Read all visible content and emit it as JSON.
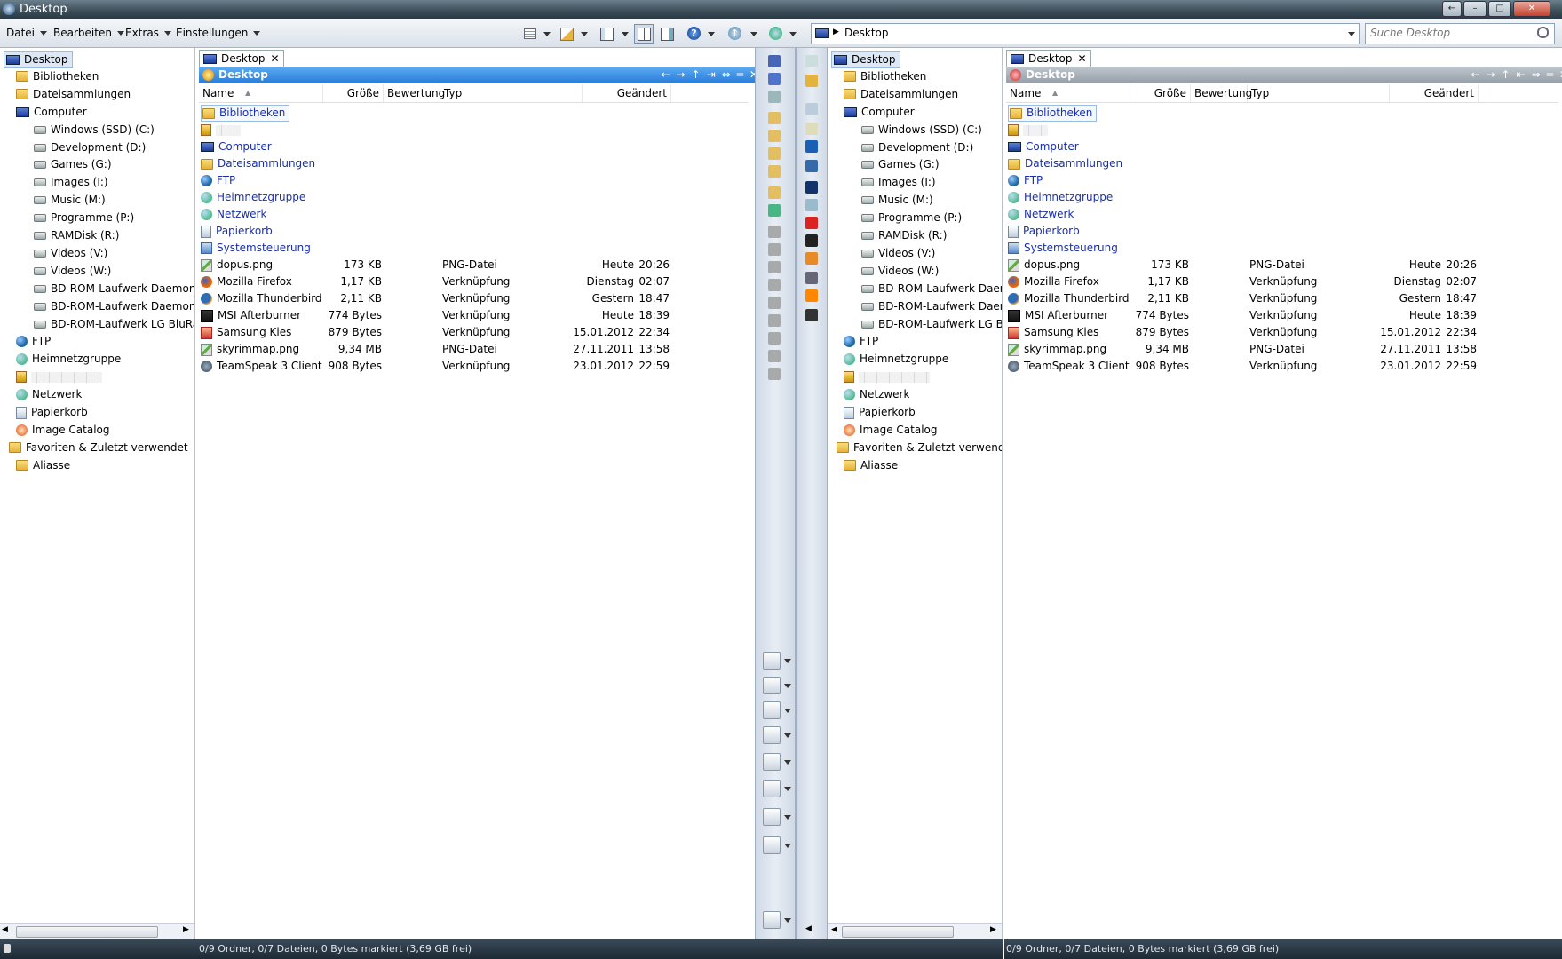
{
  "window": {
    "title": "Desktop",
    "buttons": [
      "←",
      "–",
      "□",
      "✕"
    ]
  },
  "menu": [
    "Datei",
    "Bearbeiten",
    "Extras",
    "Einstellungen"
  ],
  "address": {
    "path": "Desktop"
  },
  "search": {
    "placeholder": "Suche Desktop"
  },
  "tree": [
    {
      "label": "Desktop",
      "icon": "monitor-icon",
      "indent": 0
    },
    {
      "label": "Bibliotheken",
      "icon": "folder-icon",
      "indent": 1
    },
    {
      "label": "Dateisammlungen",
      "icon": "folder-icon",
      "indent": 1
    },
    {
      "label": "Computer",
      "icon": "monitor-icon",
      "indent": 1
    },
    {
      "label": "Windows (SSD) (C:)",
      "icon": "drive-icon",
      "indent": 2
    },
    {
      "label": "Development (D:)",
      "icon": "drive-icon",
      "indent": 2
    },
    {
      "label": "Games (G:)",
      "icon": "drive-icon",
      "indent": 2
    },
    {
      "label": "Images (I:)",
      "icon": "drive-icon",
      "indent": 2
    },
    {
      "label": "Music (M:)",
      "icon": "drive-icon",
      "indent": 2
    },
    {
      "label": "Programme (P:)",
      "icon": "drive-icon",
      "indent": 2
    },
    {
      "label": "RAMDisk (R:)",
      "icon": "drive-icon",
      "indent": 2
    },
    {
      "label": "Videos (V:)",
      "icon": "drive-icon",
      "indent": 2
    },
    {
      "label": "Videos (W:)",
      "icon": "drive-icon",
      "indent": 2
    },
    {
      "label": "BD-ROM-Laufwerk Daemon Tools",
      "icon": "drive-icon",
      "indent": 2
    },
    {
      "label": "BD-ROM-Laufwerk Daemon Tools",
      "icon": "drive-icon",
      "indent": 2
    },
    {
      "label": "BD-ROM-Laufwerk LG BluRay (Z:)",
      "icon": "drive-icon",
      "indent": 2
    },
    {
      "label": "FTP",
      "icon": "globe-icon",
      "indent": 1
    },
    {
      "label": "Heimnetzgruppe",
      "icon": "network-icon",
      "indent": 1
    },
    {
      "label": "",
      "icon": "lock-icon",
      "indent": 1
    },
    {
      "label": "Netzwerk",
      "icon": "network-icon",
      "indent": 1
    },
    {
      "label": "Papierkorb",
      "icon": "recycle-bin-icon",
      "indent": 1
    },
    {
      "label": "Image Catalog",
      "icon": "image-catalog-icon",
      "indent": 1
    },
    {
      "label": "Favoriten & Zuletzt verwendet",
      "icon": "folder-icon",
      "indent": 0
    },
    {
      "label": "Aliasse",
      "icon": "folder-icon",
      "indent": 1
    }
  ],
  "lister_left": {
    "tab": "Desktop",
    "header": "Desktop",
    "status": "0/9 Ordner, 0/7 Dateien, 0 Bytes markiert (3,69 GB frei)"
  },
  "lister_right": {
    "tab": "Desktop",
    "header": "Desktop",
    "status": "0/9 Ordner, 0/7 Dateien, 0 Bytes markiert (3,69 GB frei)"
  },
  "columns": [
    "Name",
    "Größe",
    "Bewertung",
    "Typ",
    "Geändert"
  ],
  "folders": [
    {
      "name": "Bibliotheken",
      "icon": "folder-icon"
    },
    {
      "name": "",
      "icon": "lock-icon"
    },
    {
      "name": "Computer",
      "icon": "monitor-icon"
    },
    {
      "name": "Dateisammlungen",
      "icon": "folder-icon"
    },
    {
      "name": "FTP",
      "icon": "globe-icon"
    },
    {
      "name": "Heimnetzgruppe",
      "icon": "network-icon"
    },
    {
      "name": "Netzwerk",
      "icon": "network-icon"
    },
    {
      "name": "Papierkorb",
      "icon": "recycle-bin-icon"
    },
    {
      "name": "Systemsteuerung",
      "icon": "control-panel-icon"
    }
  ],
  "files": [
    {
      "name": "dopus.png",
      "size": "173 KB",
      "type": "PNG-Datei",
      "date": "Heute",
      "time": "20:26",
      "icon": "png-icon"
    },
    {
      "name": "Mozilla Firefox",
      "size": "1,17 KB",
      "type": "Verknüpfung",
      "date": "Dienstag",
      "time": "02:07",
      "icon": "firefox-icon"
    },
    {
      "name": "Mozilla Thunderbird",
      "size": "2,11 KB",
      "type": "Verknüpfung",
      "date": "Gestern",
      "time": "18:47",
      "icon": "thunderbird-icon"
    },
    {
      "name": "MSI Afterburner",
      "size": "774 Bytes",
      "type": "Verknüpfung",
      "date": "Heute",
      "time": "18:39",
      "icon": "afterburner-icon"
    },
    {
      "name": "Samsung Kies",
      "size": "879 Bytes",
      "type": "Verknüpfung",
      "date": "15.01.2012",
      "time": "22:34",
      "icon": "kies-icon"
    },
    {
      "name": "skyrimmap.png",
      "size": "9,34 MB",
      "type": "PNG-Datei",
      "date": "27.11.2011",
      "time": "13:58",
      "icon": "png-icon"
    },
    {
      "name": "TeamSpeak 3 Client",
      "size": "908 Bytes",
      "type": "Verknüpfung",
      "date": "23.01.2012",
      "time": "22:59",
      "icon": "teamspeak-icon"
    }
  ],
  "colors": {
    "active_header": "#3a8ee6",
    "inactive_header": "#a7afb8",
    "link": "#1a2fa8"
  }
}
